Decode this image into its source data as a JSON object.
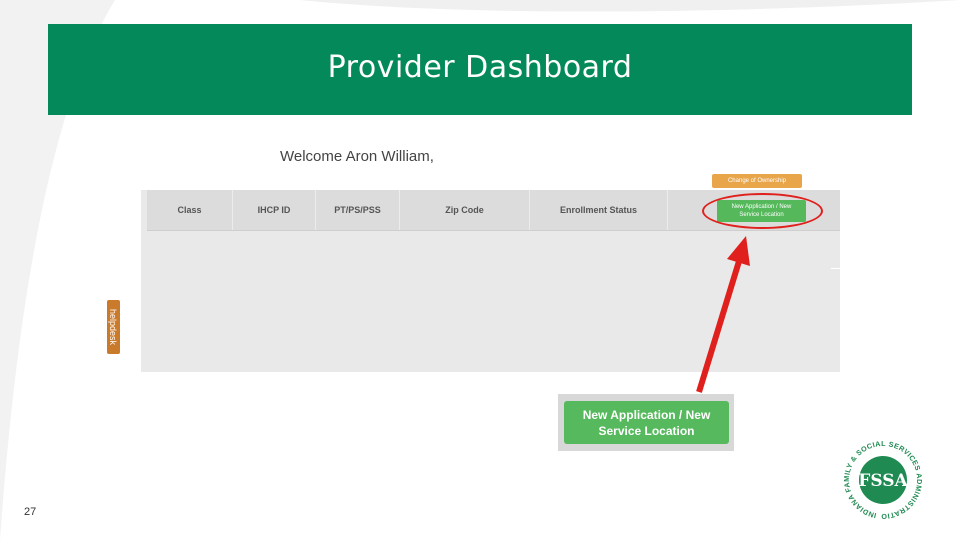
{
  "slide": {
    "title": "Provider Dashboard",
    "page_number": "27"
  },
  "portal": {
    "welcome_text": "Welcome Aron William,",
    "helpdesk_tab": "helpdesk",
    "table": {
      "columns": [
        "Class",
        "IHCP ID",
        "PT/PS/PSS",
        "Zip Code",
        "Enrollment Status"
      ]
    },
    "change_ownership_button": "Change of Ownership",
    "new_application_button_line1": "New Application / New",
    "new_application_button_line2": "Service Location"
  },
  "callout": {
    "button_line1": "New Application / New",
    "button_line2": "Service Location"
  },
  "logo": {
    "monogram": "FSSA",
    "ring_text": "INDIANA FAMILY & SOCIAL SERVICES ADMINISTRATION"
  },
  "colors": {
    "title_bar": "#048a5a",
    "button_green": "#56b95d",
    "highlight_red": "#e0201c",
    "change_ownership_orange": "#e8a54a"
  }
}
